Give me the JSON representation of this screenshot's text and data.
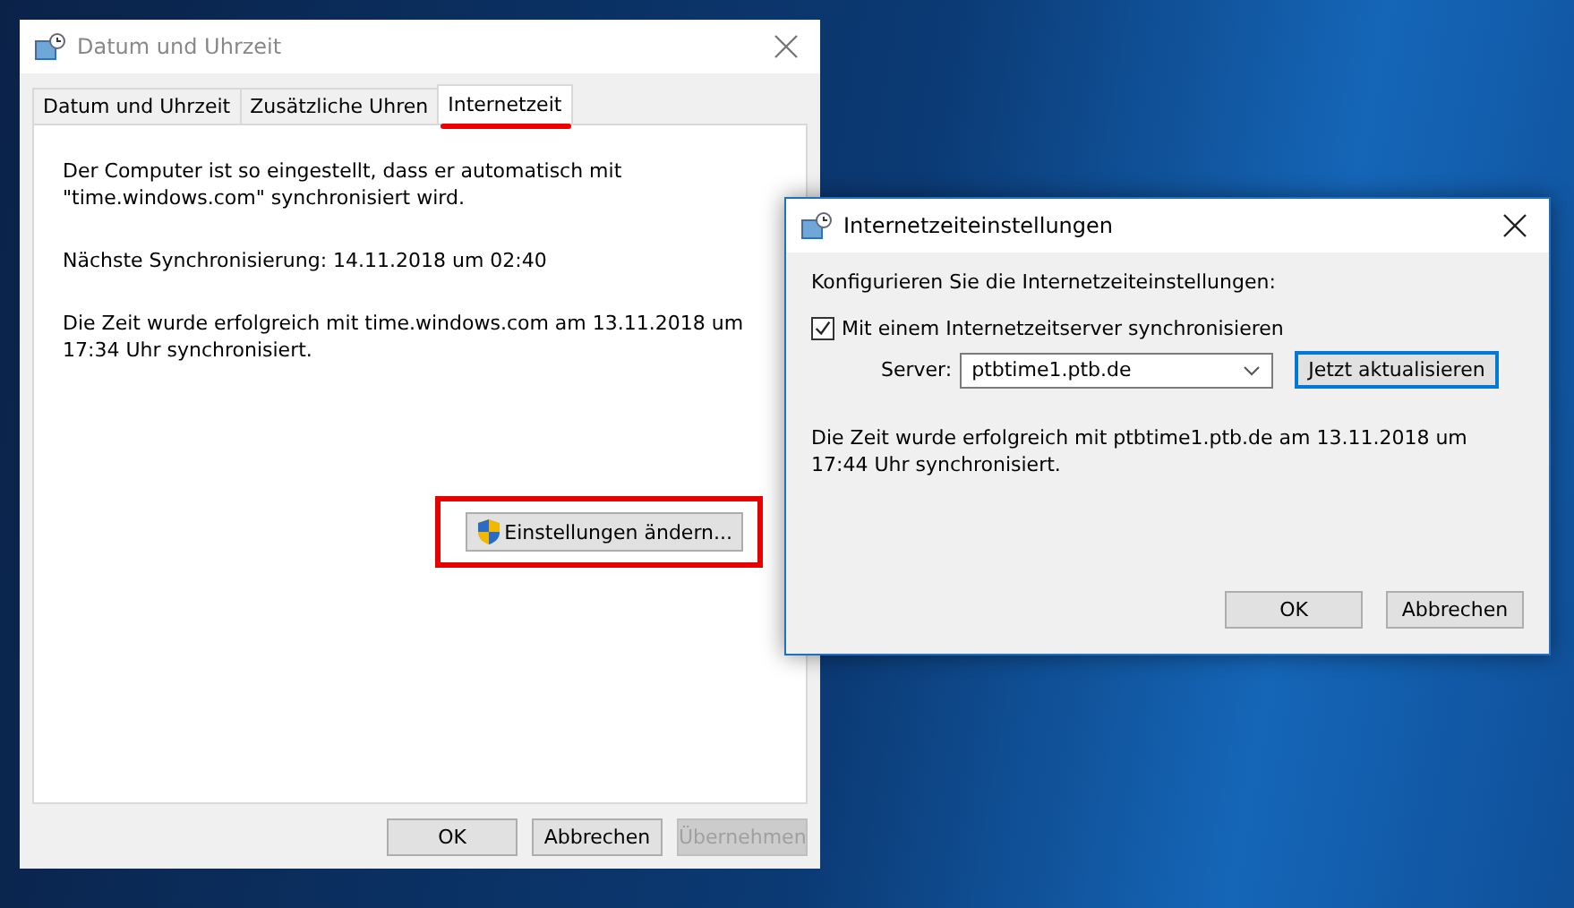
{
  "main_window": {
    "title": "Datum und Uhrzeit",
    "tabs": [
      {
        "label": "Datum und Uhrzeit",
        "selected": false,
        "marked": false
      },
      {
        "label": "Zusätzliche Uhren",
        "selected": false,
        "marked": false
      },
      {
        "label": "Internetzeit",
        "selected": true,
        "marked": true
      }
    ],
    "paragraphs": [
      "Der Computer ist so eingestellt, dass er automatisch mit \"time.windows.com\" synchronisiert wird.",
      "Nächste Synchronisierung: 14.11.2018 um 02:40",
      "Die Zeit wurde erfolgreich mit time.windows.com am 13.11.2018 um 17:34 Uhr synchronisiert."
    ],
    "settings_button": {
      "label": "Einstellungen ändern...",
      "marked": true
    },
    "buttons": [
      {
        "label": "OK",
        "disabled": false
      },
      {
        "label": "Abbrechen",
        "disabled": false
      },
      {
        "label": "Übernehmen",
        "disabled": true
      }
    ]
  },
  "dialog": {
    "title": "Internetzeiteinstellungen",
    "prompt": "Konfigurieren Sie die Internetzeiteinstellungen:",
    "sync_checkbox": {
      "label": "Mit einem Internetzeitserver synchronisieren",
      "checked": true
    },
    "server_label": "Server:",
    "server_value": "ptbtime1.ptb.de",
    "update_button": "Jetzt aktualisieren",
    "status": "Die Zeit wurde erfolgreich mit ptbtime1.ptb.de am 13.11.2018 um 17:44 Uhr synchronisiert.",
    "buttons": [
      {
        "label": "OK"
      },
      {
        "label": "Abbrechen"
      }
    ]
  }
}
